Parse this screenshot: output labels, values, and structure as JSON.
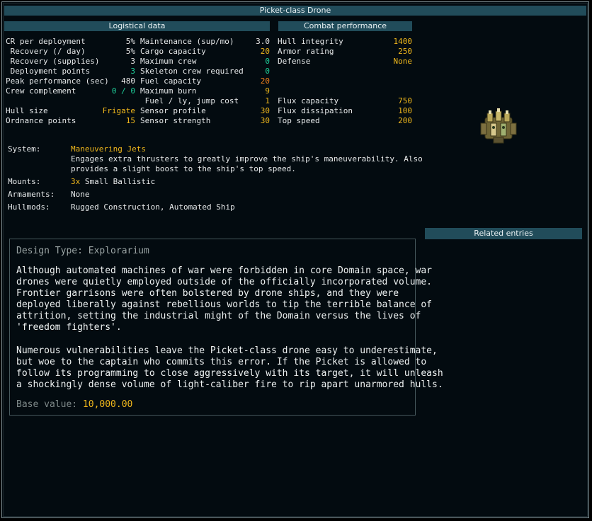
{
  "title": "Picket-class Drone",
  "logistics": {
    "header": "Logistical data",
    "col1": [
      {
        "label": "CR per deployment",
        "value": "5%",
        "color": "#e8e8e8"
      },
      {
        "label": " Recovery (/ day)",
        "value": "5%",
        "color": "#e8e8e8"
      },
      {
        "label": " Recovery (supplies)",
        "value": "3",
        "color": "#e8e8e8"
      },
      {
        "label": " Deployment points",
        "value": "3",
        "color": "#1fcf9a"
      },
      {
        "label": "Peak performance (sec)",
        "value": "480",
        "color": "#e8e8e8"
      },
      {
        "label": "Crew complement",
        "value": "0 / 0",
        "color": "#1fcf9a"
      },
      {
        "label": "",
        "value": "",
        "color": "#e8e8e8"
      },
      {
        "label": "Hull size",
        "value": "Frigate",
        "color": "#f0b81c"
      },
      {
        "label": "Ordnance points",
        "value": "15",
        "color": "#f0b81c"
      }
    ],
    "col2": [
      {
        "label": "Maintenance (sup/mo)",
        "value": "3.0",
        "color": "#e8e8e8"
      },
      {
        "label": "Cargo capacity",
        "value": "20",
        "color": "#f0b81c"
      },
      {
        "label": "Maximum crew",
        "value": "0",
        "color": "#1fcf9a"
      },
      {
        "label": "Skeleton crew required",
        "value": "0",
        "color": "#1fcf9a"
      },
      {
        "label": "Fuel capacity",
        "value": "20",
        "color": "#f07f1c"
      },
      {
        "label": "Maximum burn",
        "value": "9",
        "color": "#f0b81c"
      },
      {
        "label": " Fuel / ly, jump cost",
        "value": "1",
        "color": "#f0b81c"
      },
      {
        "label": "Sensor profile",
        "value": "30",
        "color": "#f0b81c"
      },
      {
        "label": "Sensor strength",
        "value": "30",
        "color": "#f0b81c"
      }
    ]
  },
  "combat": {
    "header": "Combat performance",
    "rows": [
      {
        "label": "Hull integrity",
        "value": "1400",
        "color": "#f0b81c"
      },
      {
        "label": "Armor rating",
        "value": "250",
        "color": "#f0b81c"
      },
      {
        "label": "Defense",
        "value": "None",
        "color": "#f0b81c"
      },
      {
        "label": "",
        "value": "",
        "color": "#e8e8e8"
      },
      {
        "label": "",
        "value": "",
        "color": "#e8e8e8"
      },
      {
        "label": "",
        "value": "",
        "color": "#e8e8e8"
      },
      {
        "label": "Flux capacity",
        "value": "750",
        "color": "#f0b81c"
      },
      {
        "label": "Flux dissipation",
        "value": "100",
        "color": "#f0b81c"
      },
      {
        "label": "Top speed",
        "value": "200",
        "color": "#f0b81c"
      }
    ]
  },
  "system": {
    "label": "System:",
    "name": "Maneuvering Jets",
    "desc1": "Engages extra thrusters to greatly improve the ship's maneuverability. Also",
    "desc2": "provides a slight boost to the ship's top speed."
  },
  "mounts": {
    "label": "Mounts:",
    "count": "3x",
    "text": " Small Ballistic"
  },
  "armaments": {
    "label": "Armaments:",
    "value": "None"
  },
  "hullmods": {
    "label": "Hullmods:",
    "value": "Rugged Construction, Automated Ship"
  },
  "related": {
    "header": "Related entries"
  },
  "description": {
    "design_type": "Design Type: Explorarium",
    "para1": [
      "Although automated machines of war were forbidden in core Domain space, war",
      "drones were quietly employed outside of the officially incorporated volume.",
      "Frontier garrisons were often bolstered by drone ships, and they were",
      "deployed liberally against rebellious worlds to tip the terrible balance of",
      "attrition, setting the industrial might of the Domain versus the lives of",
      "'freedom fighters'."
    ],
    "para2": [
      "Numerous vulnerabilities leave the Picket-class drone easy to underestimate,",
      "but woe to the captain who commits this error. If the Picket is allowed to",
      "follow its programming to close aggressively with its target, it will unleash",
      "a shockingly dense volume of light-caliber fire to rip apart unarmored hulls."
    ],
    "base_label": "Base value: ",
    "base_value": "10,000.00"
  },
  "colors": {
    "accent": "#214c5a",
    "yellow": "#f0b81c",
    "green": "#1fcf9a",
    "orange": "#f07f1c"
  },
  "icons": {
    "ship": "picket-drone-sprite"
  }
}
